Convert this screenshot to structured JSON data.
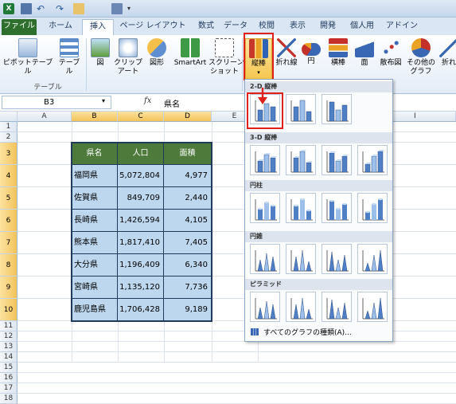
{
  "app": {
    "title": "Microsoft Excel"
  },
  "tabs": [
    "ファイル",
    "ホーム",
    "挿入",
    "ページ レイアウト",
    "数式",
    "データ",
    "校閲",
    "表示",
    "開発",
    "個人用",
    "アドイン"
  ],
  "ribbon": {
    "buttons": [
      "ピボットテーブル",
      "テーブル",
      "図",
      "クリップ\nアート",
      "図形",
      "SmartArt",
      "スクリーン\nショット",
      "縦棒",
      "折れ線",
      "円",
      "横棒",
      "面",
      "散布図",
      "その他の\nグラフ",
      "折れ"
    ],
    "groups": {
      "table": "テーブル"
    }
  },
  "formula_bar": {
    "name_box": "B3",
    "fx": "fx",
    "value": "県名"
  },
  "columns": [
    "A",
    "B",
    "C",
    "D",
    "E",
    "I"
  ],
  "rows": [
    "1",
    "2",
    "3",
    "4",
    "5",
    "6",
    "7",
    "8",
    "9",
    "10",
    "11",
    "12",
    "13",
    "14",
    "15",
    "16",
    "17",
    "18"
  ],
  "table": {
    "headers": [
      "県名",
      "人口",
      "面積"
    ],
    "rows": [
      [
        "福岡県",
        "5,072,804",
        "4,977"
      ],
      [
        "佐賀県",
        "849,709",
        "2,440"
      ],
      [
        "長崎県",
        "1,426,594",
        "4,105"
      ],
      [
        "熊本県",
        "1,817,410",
        "7,405"
      ],
      [
        "大分県",
        "1,196,409",
        "6,340"
      ],
      [
        "宮崎県",
        "1,135,120",
        "7,736"
      ],
      [
        "鹿児島県",
        "1,706,428",
        "9,189"
      ]
    ]
  },
  "chart_menu": {
    "sections": [
      "2-D 縦棒",
      "3-D 縦棒",
      "円柱",
      "円錐",
      "ピラミッド"
    ],
    "all_charts": "すべてのグラフの種類(A)..."
  },
  "colors": {
    "accent": "#2f6f2d",
    "header_fill": "#4e7a3c",
    "data_fill": "#bdd7ee",
    "highlight": "#e0201a"
  }
}
